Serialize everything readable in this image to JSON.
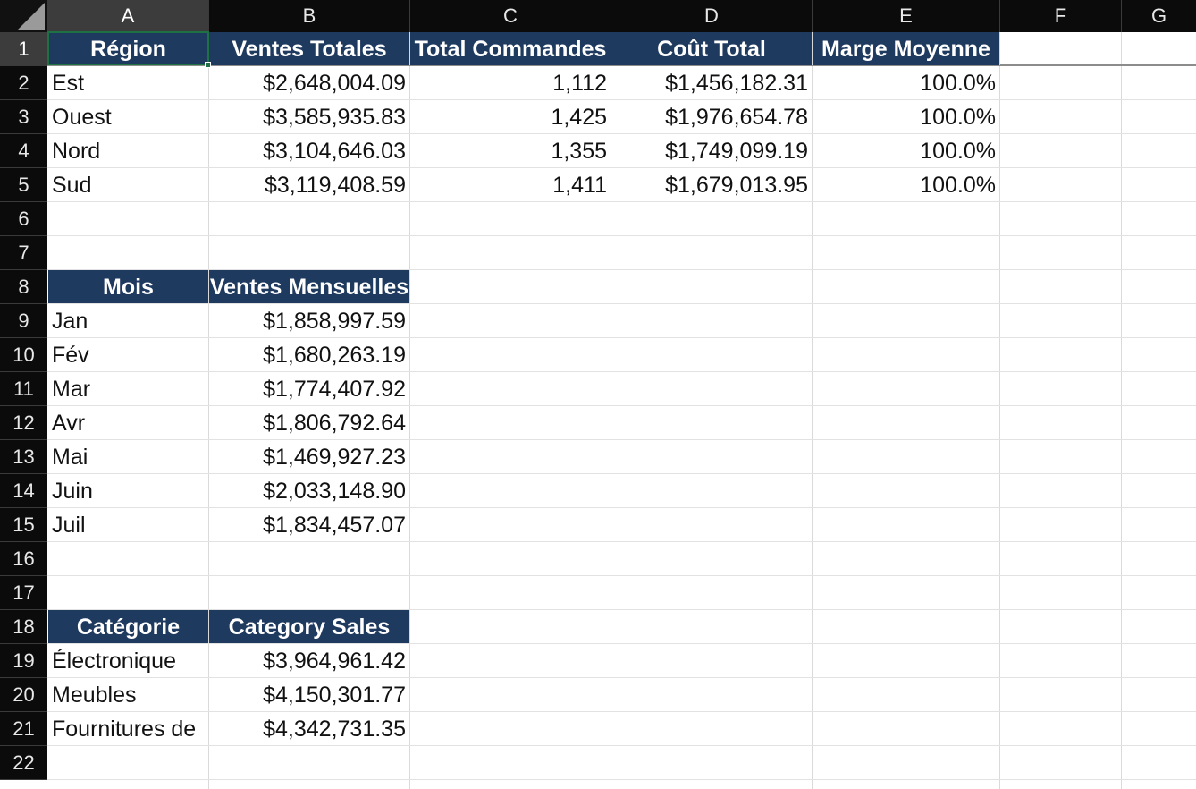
{
  "columns": [
    "A",
    "B",
    "C",
    "D",
    "E",
    "F",
    "G"
  ],
  "active_column": "A",
  "rows": [
    "1",
    "2",
    "3",
    "4",
    "5",
    "6",
    "7",
    "8",
    "9",
    "10",
    "11",
    "12",
    "13",
    "14",
    "15",
    "16",
    "17",
    "18",
    "19",
    "20",
    "21",
    "22"
  ],
  "active_row": "1",
  "region_table": {
    "headers": [
      "Région",
      "Ventes Totales",
      "Total Commandes",
      "Coût Total",
      "Marge Moyenne"
    ],
    "rows": [
      [
        "Est",
        "$2,648,004.09",
        "1,112",
        "$1,456,182.31",
        "100.0%"
      ],
      [
        "Ouest",
        "$3,585,935.83",
        "1,425",
        "$1,976,654.78",
        "100.0%"
      ],
      [
        "Nord",
        "$3,104,646.03",
        "1,355",
        "$1,749,099.19",
        "100.0%"
      ],
      [
        "Sud",
        "$3,119,408.59",
        "1,411",
        "$1,679,013.95",
        "100.0%"
      ]
    ]
  },
  "month_table": {
    "headers": [
      "Mois",
      "Ventes Mensuelles"
    ],
    "rows": [
      [
        "Jan",
        "$1,858,997.59"
      ],
      [
        "Fév",
        "$1,680,263.19"
      ],
      [
        "Mar",
        "$1,774,407.92"
      ],
      [
        "Avr",
        "$1,806,792.64"
      ],
      [
        "Mai",
        "$1,469,927.23"
      ],
      [
        "Juin",
        "$2,033,148.90"
      ],
      [
        "Juil",
        "$1,834,457.07"
      ]
    ]
  },
  "category_table": {
    "headers": [
      "Catégorie",
      "Category Sales"
    ],
    "rows": [
      [
        "Électronique",
        "$3,964,961.42"
      ],
      [
        "Meubles",
        "$4,150,301.77"
      ],
      [
        "Fournitures de",
        "$4,342,731.35"
      ]
    ]
  },
  "colors": {
    "header_fill": "#1f3a5f",
    "selection": "#1e7145",
    "chrome": "#0b0b0b"
  }
}
